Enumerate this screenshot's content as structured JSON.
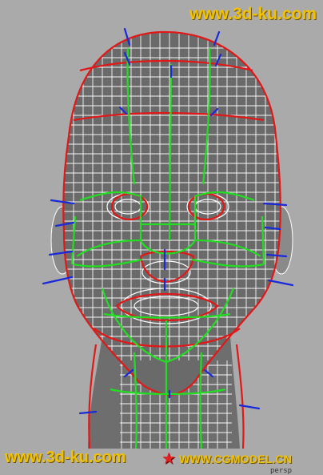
{
  "viewport": {
    "view_label": "persp",
    "model": "head-wireframe-mesh"
  },
  "watermarks": {
    "top_url": "www.3d-ku.com",
    "bottom_url": "www.3d-ku.com",
    "logo_text": "WWW.CGMODEL.CN",
    "logo_icon": "star-icon"
  },
  "colors": {
    "background": "#aaaaaa",
    "mesh_fill": "#6a6a6a",
    "wire": "#ffffff",
    "edge_loop_red": "#e01818",
    "edge_loop_green": "#22dd22",
    "normal_blue": "#1a2ad8",
    "watermark": "#f2c200"
  }
}
